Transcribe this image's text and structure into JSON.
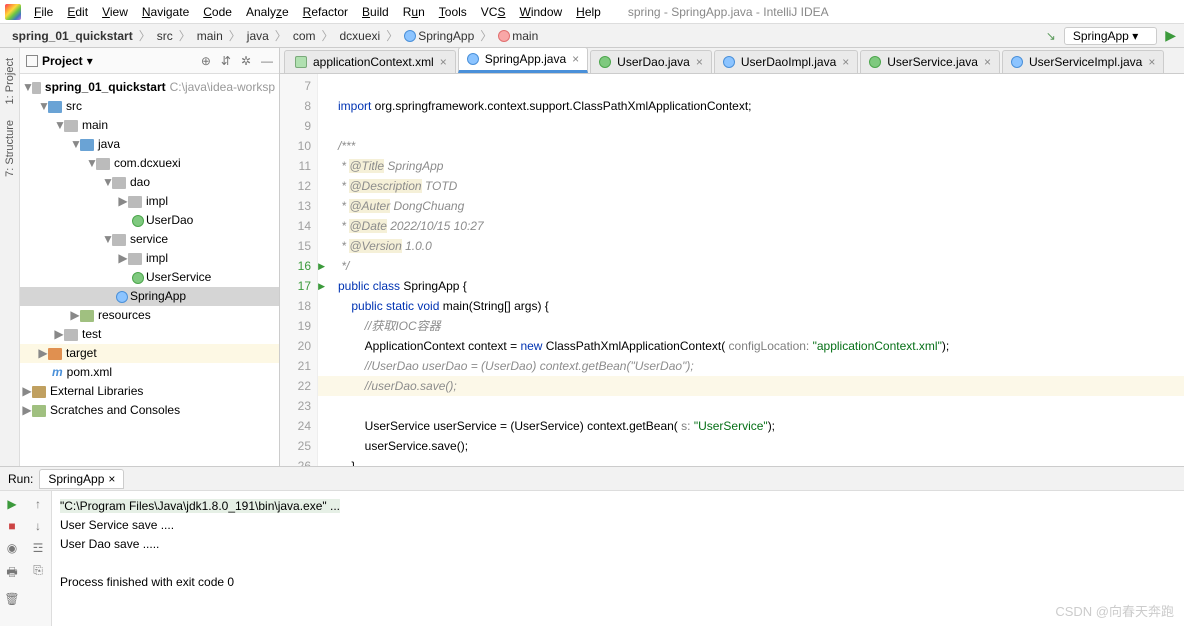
{
  "window_title": "spring - SpringApp.java - IntelliJ IDEA",
  "menu": [
    "File",
    "Edit",
    "View",
    "Navigate",
    "Code",
    "Analyze",
    "Refactor",
    "Build",
    "Run",
    "Tools",
    "VCS",
    "Window",
    "Help"
  ],
  "breadcrumbs": [
    "spring_01_quickstart",
    "src",
    "main",
    "java",
    "com",
    "dcxuexi",
    "SpringApp",
    "main"
  ],
  "run_config": "SpringApp",
  "project_label": "Project",
  "sidetabs": {
    "project": "1: Project",
    "structure": "7: Structure"
  },
  "tree": {
    "root": "spring_01_quickstart",
    "root_path": "C:\\java\\idea-worksp",
    "src": "src",
    "main": "main",
    "java": "java",
    "pkg": "com.dcxuexi",
    "dao": "dao",
    "impl1": "impl",
    "userdao": "UserDao",
    "service": "service",
    "impl2": "impl",
    "userservice": "UserService",
    "springapp": "SpringApp",
    "resources": "resources",
    "test": "test",
    "target": "target",
    "pom": "pom.xml",
    "extlib": "External Libraries",
    "scratches": "Scratches and Consoles"
  },
  "tabs": [
    {
      "label": "applicationContext.xml",
      "icon": "x",
      "active": false,
      "close": true
    },
    {
      "label": "SpringApp.java",
      "icon": "c",
      "active": true,
      "close": true
    },
    {
      "label": "UserDao.java",
      "icon": "i",
      "active": false,
      "close": true
    },
    {
      "label": "UserDaoImpl.java",
      "icon": "c",
      "active": false,
      "close": true
    },
    {
      "label": "UserService.java",
      "icon": "i",
      "active": false,
      "close": true
    },
    {
      "label": "UserServiceImpl.java",
      "icon": "c",
      "active": false,
      "close": true
    }
  ],
  "gutter_start": 7,
  "gutter_end": 26,
  "code": {
    "l7": "import org.springframework.context.support.ClassPathXmlApplicationContext;",
    "l8": "",
    "l9": "/***",
    "l10_tag": "@Title",
    "l10_rest": " SpringApp",
    "l11_tag": "@Description",
    "l11_rest": " TOTD",
    "l12_tag": "@Auter",
    "l12_rest": " DongChuang",
    "l13_tag": "@Date",
    "l13_rest": " 2022/10/15 10:27",
    "l14_tag": "@Version",
    "l14_rest": " 1.0.0",
    "l15": " */",
    "l16_a": "public class ",
    "l16_b": "SpringApp {",
    "l17_a": "public static void ",
    "l17_b": "main",
    "l17_c": "(String[] args) {",
    "l18": "//获取IOC容器",
    "l19_a": "ApplicationContext context = ",
    "l19_new": "new",
    "l19_b": " ClassPathXmlApplicationContext(",
    "l19_p": " configLocation: ",
    "l19_s": "\"applicationContext.xml\"",
    "l19_e": ");",
    "l20": "//UserDao userDao = (UserDao) context.getBean(\"UserDao\");",
    "l21": "//userDao.save();",
    "l22_a": "UserService userService = (UserService) context.getBean(",
    "l22_p": " s: ",
    "l22_s": "\"UserService\"",
    "l22_e": ");",
    "l23": "userService.save();",
    "l24": "}",
    "l25": "}"
  },
  "run": {
    "label": "Run:",
    "tab": "SpringApp",
    "line1": "\"C:\\Program Files\\Java\\jdk1.8.0_191\\bin\\java.exe\" ...",
    "line2": "User Service save ....",
    "line3": "User Dao save .....",
    "line4": "Process finished with exit code 0"
  },
  "watermark": "CSDN @向春天奔跑"
}
